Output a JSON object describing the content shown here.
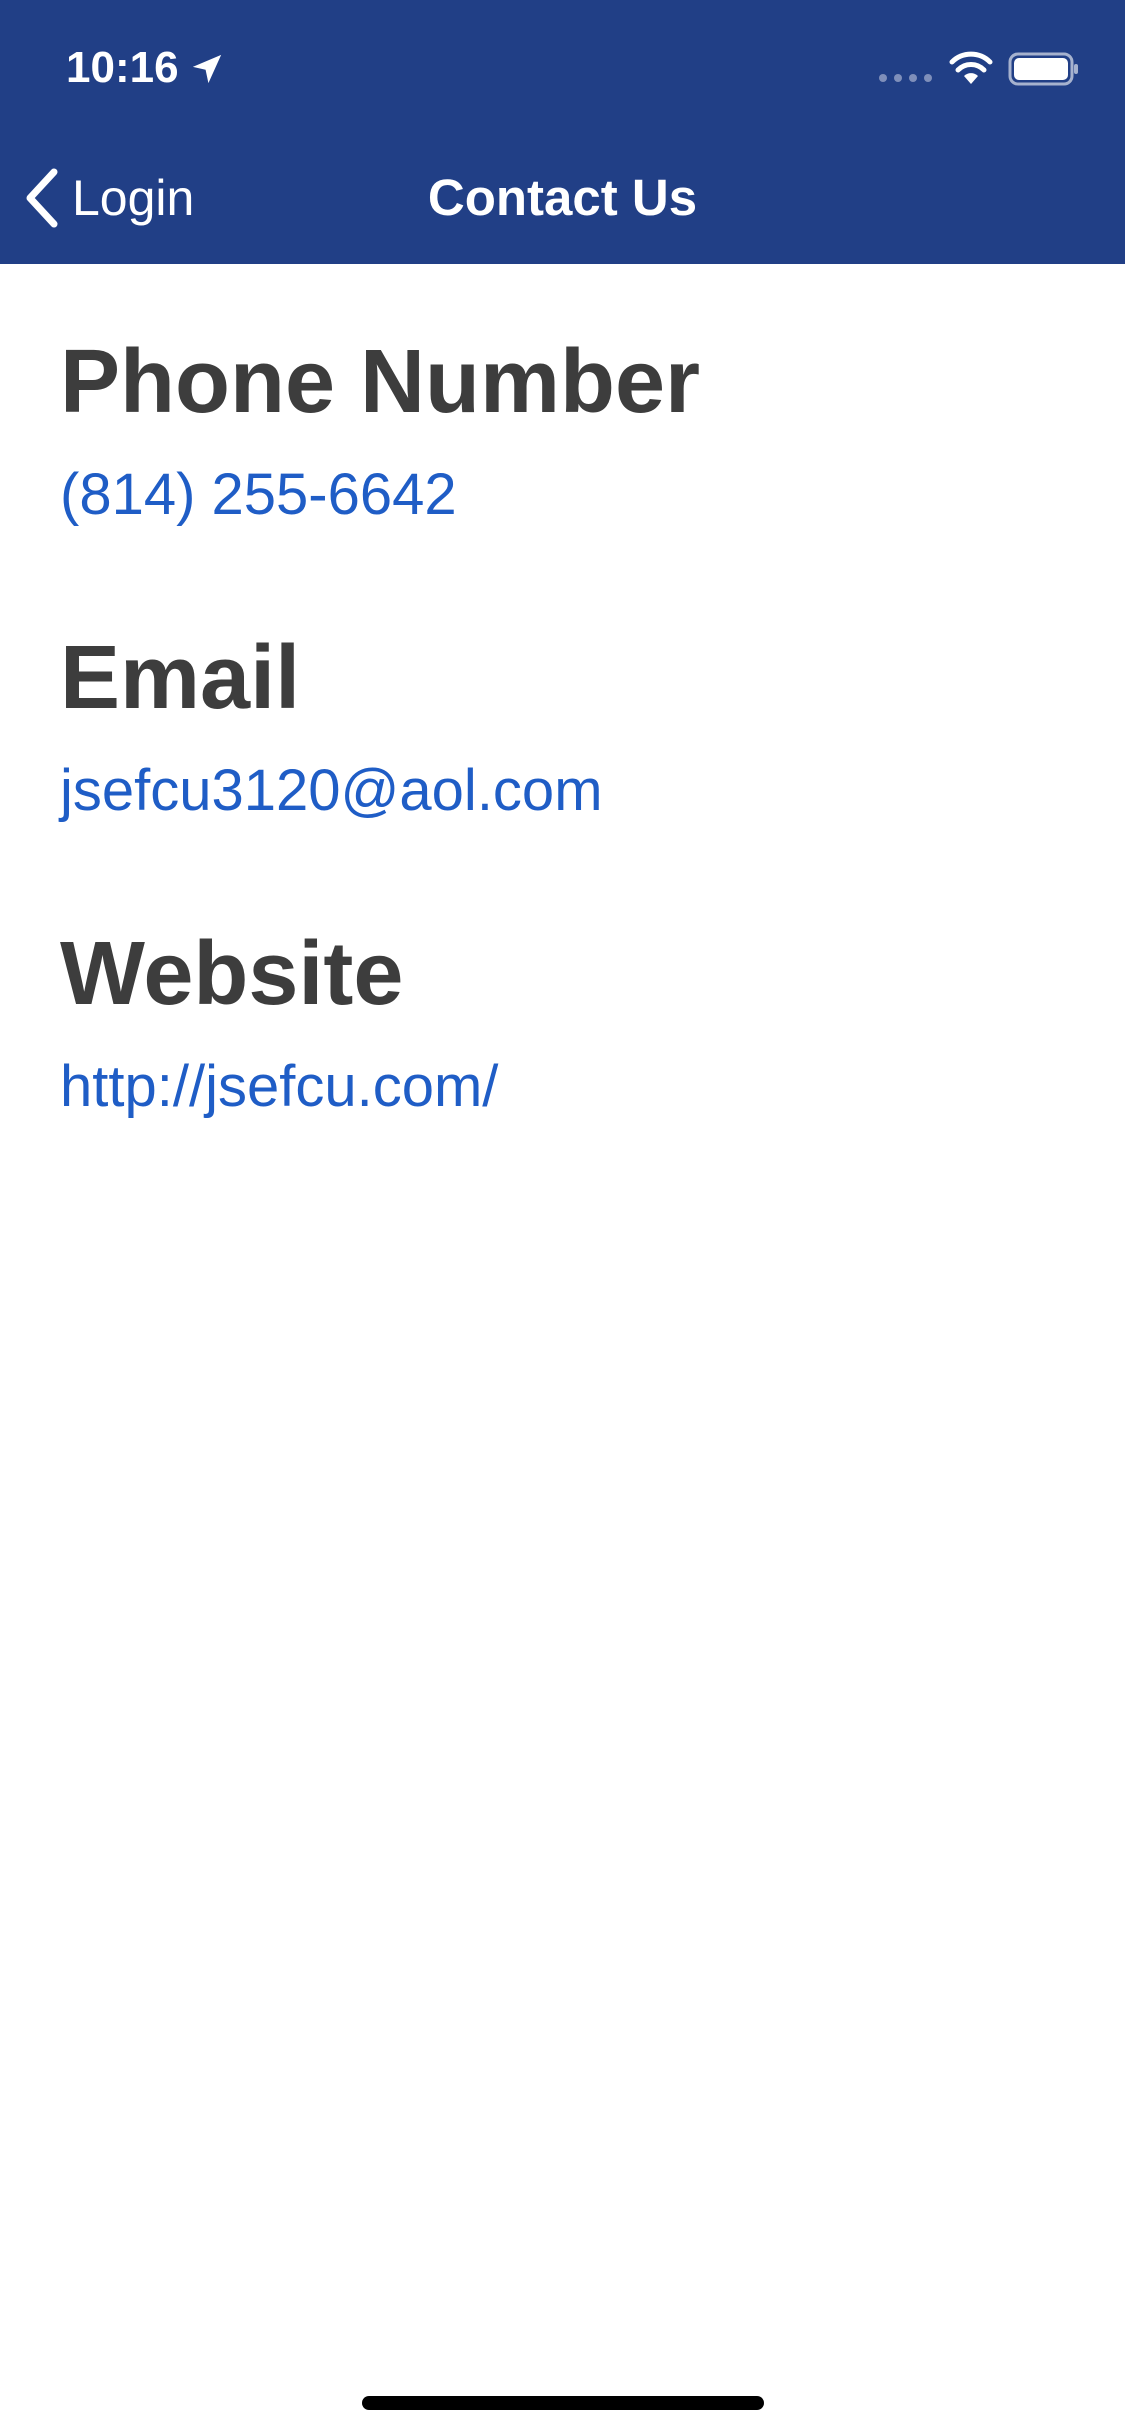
{
  "status_bar": {
    "time": "10:16"
  },
  "nav": {
    "back_label": "Login",
    "title": "Contact Us"
  },
  "sections": {
    "phone": {
      "heading": "Phone Number",
      "value": "(814) 255-6642"
    },
    "email": {
      "heading": "Email",
      "value": "jsefcu3120@aol.com"
    },
    "website": {
      "heading": "Website",
      "value": "http://jsefcu.com/"
    }
  },
  "colors": {
    "header_bg": "#213f86",
    "heading_text": "#3d3d3d",
    "link_text": "#1f5dc6"
  }
}
